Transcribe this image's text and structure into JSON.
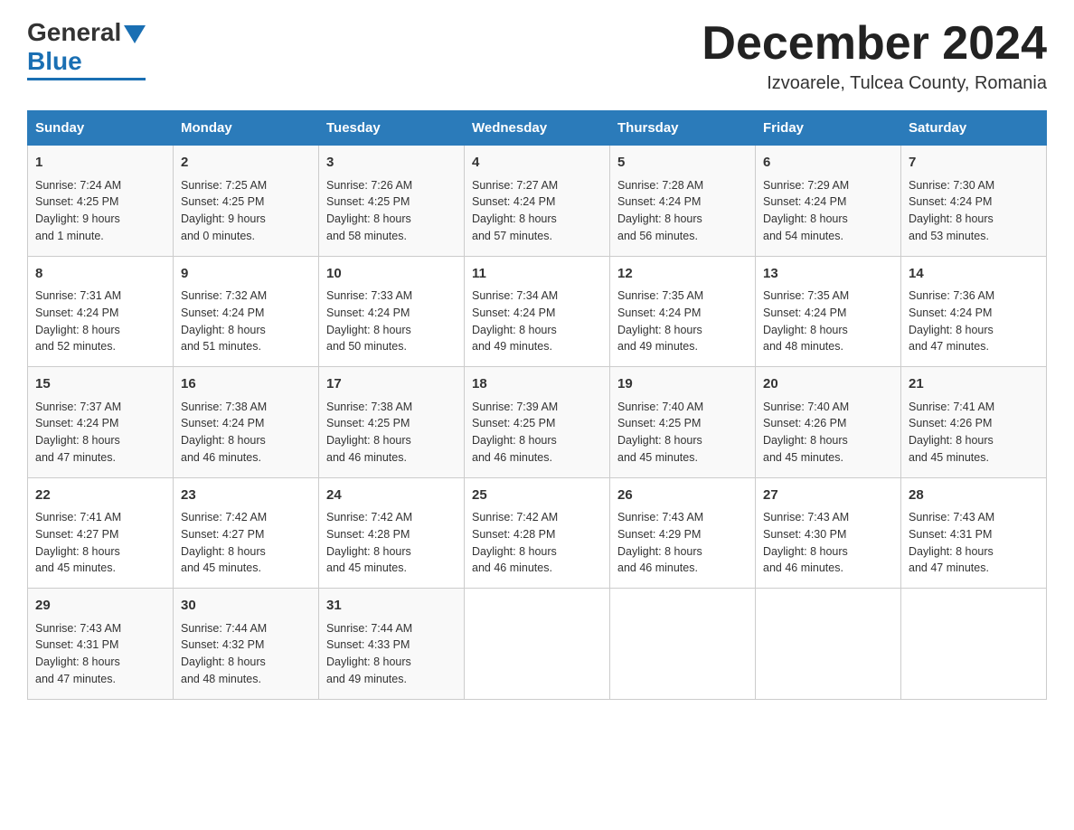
{
  "header": {
    "logo": {
      "general": "General",
      "blue": "Blue"
    },
    "title": "December 2024",
    "location": "Izvoarele, Tulcea County, Romania"
  },
  "days_of_week": [
    "Sunday",
    "Monday",
    "Tuesday",
    "Wednesday",
    "Thursday",
    "Friday",
    "Saturday"
  ],
  "weeks": [
    [
      {
        "day": "1",
        "sunrise": "7:24 AM",
        "sunset": "4:25 PM",
        "daylight": "9 hours and 1 minute."
      },
      {
        "day": "2",
        "sunrise": "7:25 AM",
        "sunset": "4:25 PM",
        "daylight": "9 hours and 0 minutes."
      },
      {
        "day": "3",
        "sunrise": "7:26 AM",
        "sunset": "4:25 PM",
        "daylight": "8 hours and 58 minutes."
      },
      {
        "day": "4",
        "sunrise": "7:27 AM",
        "sunset": "4:24 PM",
        "daylight": "8 hours and 57 minutes."
      },
      {
        "day": "5",
        "sunrise": "7:28 AM",
        "sunset": "4:24 PM",
        "daylight": "8 hours and 56 minutes."
      },
      {
        "day": "6",
        "sunrise": "7:29 AM",
        "sunset": "4:24 PM",
        "daylight": "8 hours and 54 minutes."
      },
      {
        "day": "7",
        "sunrise": "7:30 AM",
        "sunset": "4:24 PM",
        "daylight": "8 hours and 53 minutes."
      }
    ],
    [
      {
        "day": "8",
        "sunrise": "7:31 AM",
        "sunset": "4:24 PM",
        "daylight": "8 hours and 52 minutes."
      },
      {
        "day": "9",
        "sunrise": "7:32 AM",
        "sunset": "4:24 PM",
        "daylight": "8 hours and 51 minutes."
      },
      {
        "day": "10",
        "sunrise": "7:33 AM",
        "sunset": "4:24 PM",
        "daylight": "8 hours and 50 minutes."
      },
      {
        "day": "11",
        "sunrise": "7:34 AM",
        "sunset": "4:24 PM",
        "daylight": "8 hours and 49 minutes."
      },
      {
        "day": "12",
        "sunrise": "7:35 AM",
        "sunset": "4:24 PM",
        "daylight": "8 hours and 49 minutes."
      },
      {
        "day": "13",
        "sunrise": "7:35 AM",
        "sunset": "4:24 PM",
        "daylight": "8 hours and 48 minutes."
      },
      {
        "day": "14",
        "sunrise": "7:36 AM",
        "sunset": "4:24 PM",
        "daylight": "8 hours and 47 minutes."
      }
    ],
    [
      {
        "day": "15",
        "sunrise": "7:37 AM",
        "sunset": "4:24 PM",
        "daylight": "8 hours and 47 minutes."
      },
      {
        "day": "16",
        "sunrise": "7:38 AM",
        "sunset": "4:24 PM",
        "daylight": "8 hours and 46 minutes."
      },
      {
        "day": "17",
        "sunrise": "7:38 AM",
        "sunset": "4:25 PM",
        "daylight": "8 hours and 46 minutes."
      },
      {
        "day": "18",
        "sunrise": "7:39 AM",
        "sunset": "4:25 PM",
        "daylight": "8 hours and 46 minutes."
      },
      {
        "day": "19",
        "sunrise": "7:40 AM",
        "sunset": "4:25 PM",
        "daylight": "8 hours and 45 minutes."
      },
      {
        "day": "20",
        "sunrise": "7:40 AM",
        "sunset": "4:26 PM",
        "daylight": "8 hours and 45 minutes."
      },
      {
        "day": "21",
        "sunrise": "7:41 AM",
        "sunset": "4:26 PM",
        "daylight": "8 hours and 45 minutes."
      }
    ],
    [
      {
        "day": "22",
        "sunrise": "7:41 AM",
        "sunset": "4:27 PM",
        "daylight": "8 hours and 45 minutes."
      },
      {
        "day": "23",
        "sunrise": "7:42 AM",
        "sunset": "4:27 PM",
        "daylight": "8 hours and 45 minutes."
      },
      {
        "day": "24",
        "sunrise": "7:42 AM",
        "sunset": "4:28 PM",
        "daylight": "8 hours and 45 minutes."
      },
      {
        "day": "25",
        "sunrise": "7:42 AM",
        "sunset": "4:28 PM",
        "daylight": "8 hours and 46 minutes."
      },
      {
        "day": "26",
        "sunrise": "7:43 AM",
        "sunset": "4:29 PM",
        "daylight": "8 hours and 46 minutes."
      },
      {
        "day": "27",
        "sunrise": "7:43 AM",
        "sunset": "4:30 PM",
        "daylight": "8 hours and 46 minutes."
      },
      {
        "day": "28",
        "sunrise": "7:43 AM",
        "sunset": "4:31 PM",
        "daylight": "8 hours and 47 minutes."
      }
    ],
    [
      {
        "day": "29",
        "sunrise": "7:43 AM",
        "sunset": "4:31 PM",
        "daylight": "8 hours and 47 minutes."
      },
      {
        "day": "30",
        "sunrise": "7:44 AM",
        "sunset": "4:32 PM",
        "daylight": "8 hours and 48 minutes."
      },
      {
        "day": "31",
        "sunrise": "7:44 AM",
        "sunset": "4:33 PM",
        "daylight": "8 hours and 49 minutes."
      },
      null,
      null,
      null,
      null
    ]
  ],
  "labels": {
    "sunrise": "Sunrise:",
    "sunset": "Sunset:",
    "daylight": "Daylight:"
  }
}
